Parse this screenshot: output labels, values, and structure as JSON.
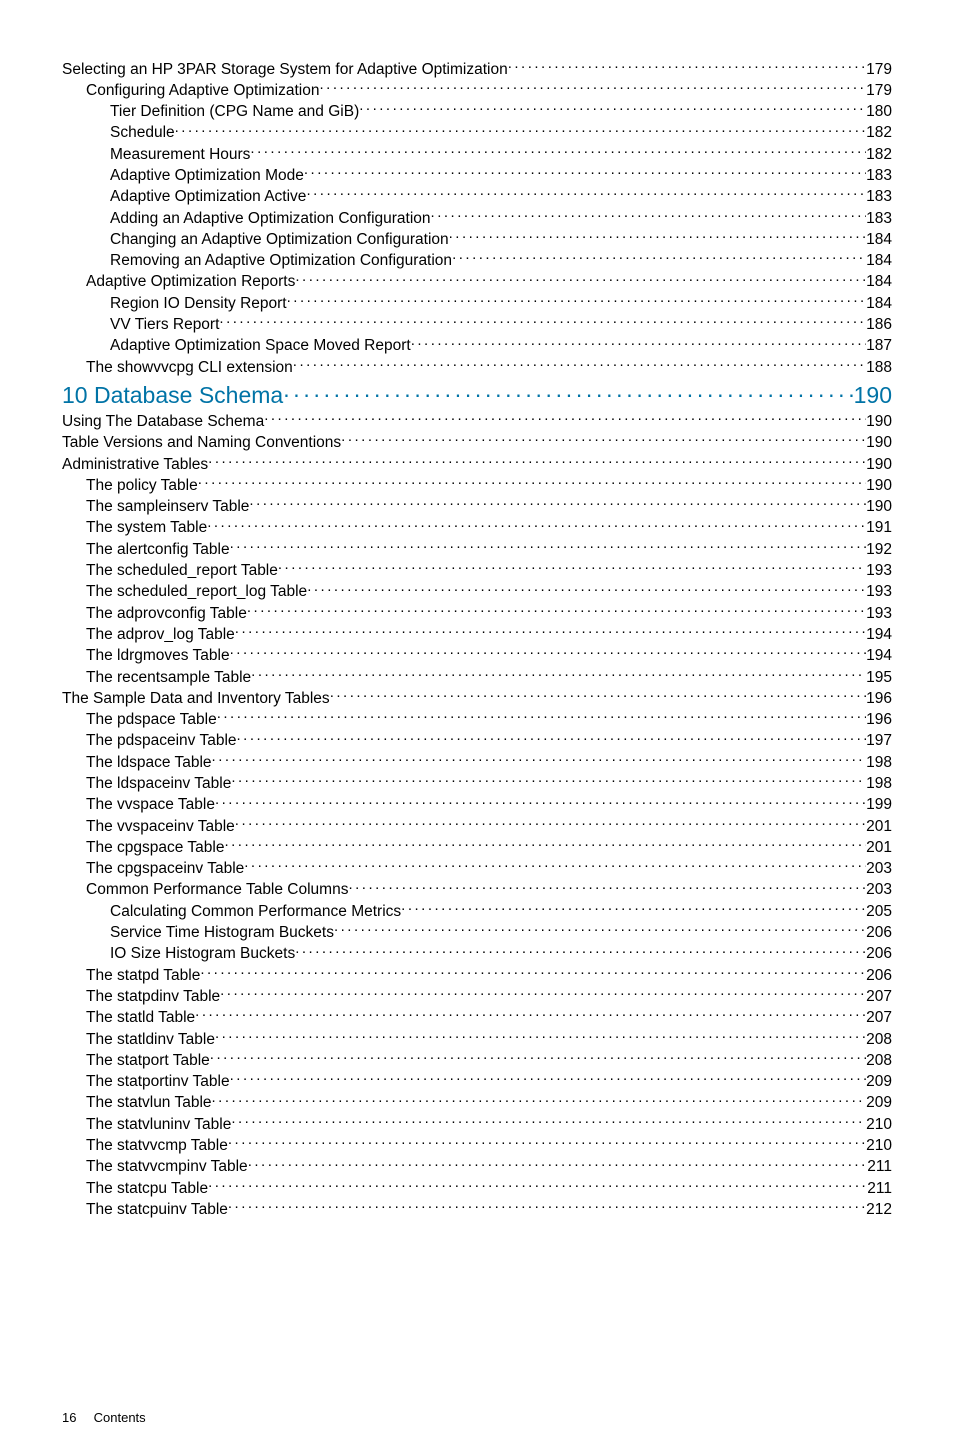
{
  "toc": [
    {
      "level": 0,
      "title": "Selecting an HP 3PAR Storage System for Adaptive Optimization",
      "page": "179",
      "style": "normal"
    },
    {
      "level": 1,
      "title": "Configuring Adaptive Optimization",
      "page": "179",
      "style": "normal"
    },
    {
      "level": 2,
      "title": "Tier Definition (CPG Name and GiB)",
      "page": "180",
      "style": "normal"
    },
    {
      "level": 2,
      "title": "Schedule",
      "page": "182",
      "style": "normal"
    },
    {
      "level": 2,
      "title": "Measurement  Hours",
      "page": "182",
      "style": "normal"
    },
    {
      "level": 2,
      "title": "Adaptive Optimization Mode",
      "page": "183",
      "style": "normal"
    },
    {
      "level": 2,
      "title": "Adaptive Optimization Active",
      "page": "183",
      "style": "normal"
    },
    {
      "level": 2,
      "title": "Adding an Adaptive Optimization Configuration",
      "page": "183",
      "style": "normal"
    },
    {
      "level": 2,
      "title": "Changing an Adaptive Optimization Configuration",
      "page": "184",
      "style": "normal"
    },
    {
      "level": 2,
      "title": "Removing an Adaptive Optimization Configuration",
      "page": "184",
      "style": "normal"
    },
    {
      "level": 1,
      "title": "Adaptive Optimization Reports",
      "page": "184",
      "style": "normal"
    },
    {
      "level": 2,
      "title": "Region IO Density Report",
      "page": "184",
      "style": "normal"
    },
    {
      "level": 2,
      "title": "VV Tiers Report",
      "page": "186",
      "style": "normal"
    },
    {
      "level": 2,
      "title": "Adaptive Optimization Space Moved Report",
      "page": "187",
      "style": "normal"
    },
    {
      "level": 1,
      "title": "The showvvcpg CLI extension",
      "page": "188",
      "style": "normal"
    },
    {
      "level": 0,
      "title": "10 Database Schema",
      "page": "190",
      "style": "chapter"
    },
    {
      "level": 0,
      "title": "Using The Database Schema",
      "page": "190",
      "style": "normal"
    },
    {
      "level": 0,
      "title": "Table Versions and Naming Conventions",
      "page": "190",
      "style": "normal"
    },
    {
      "level": 0,
      "title": "Administrative Tables",
      "page": "190",
      "style": "normal"
    },
    {
      "level": 1,
      "title": "The policy Table",
      "page": "190",
      "style": "normal"
    },
    {
      "level": 1,
      "title": "The sampleinserv Table",
      "page": "190",
      "style": "normal"
    },
    {
      "level": 1,
      "title": "The system Table",
      "page": "191",
      "style": "normal"
    },
    {
      "level": 1,
      "title": "The alertconfig Table",
      "page": "192",
      "style": "normal"
    },
    {
      "level": 1,
      "title": "The scheduled_report Table",
      "page": "193",
      "style": "normal"
    },
    {
      "level": 1,
      "title": "The scheduled_report_log Table",
      "page": "193",
      "style": "normal"
    },
    {
      "level": 1,
      "title": "The adprovconfig Table",
      "page": "193",
      "style": "normal"
    },
    {
      "level": 1,
      "title": "The adprov_log Table",
      "page": "194",
      "style": "normal"
    },
    {
      "level": 1,
      "title": "The ldrgmoves Table",
      "page": "194",
      "style": "normal"
    },
    {
      "level": 1,
      "title": "The recentsample Table",
      "page": "195",
      "style": "normal"
    },
    {
      "level": 0,
      "title": "The Sample Data and Inventory Tables",
      "page": "196",
      "style": "normal"
    },
    {
      "level": 1,
      "title": "The pdspace Table",
      "page": "196",
      "style": "normal"
    },
    {
      "level": 1,
      "title": "The pdspaceinv Table",
      "page": "197",
      "style": "normal"
    },
    {
      "level": 1,
      "title": "The ldspace Table",
      "page": "198",
      "style": "normal"
    },
    {
      "level": 1,
      "title": "The ldspaceinv Table",
      "page": "198",
      "style": "normal"
    },
    {
      "level": 1,
      "title": "The vvspace Table",
      "page": "199",
      "style": "normal"
    },
    {
      "level": 1,
      "title": "The vvspaceinv Table",
      "page": "201",
      "style": "normal"
    },
    {
      "level": 1,
      "title": "The cpgspace Table",
      "page": "201",
      "style": "normal"
    },
    {
      "level": 1,
      "title": "The cpgspaceinv Table",
      "page": "203",
      "style": "normal"
    },
    {
      "level": 1,
      "title": "Common Performance Table Columns",
      "page": "203",
      "style": "normal"
    },
    {
      "level": 2,
      "title": "Calculating Common Performance Metrics",
      "page": "205",
      "style": "normal"
    },
    {
      "level": 2,
      "title": "Service Time Histogram Buckets",
      "page": "206",
      "style": "normal"
    },
    {
      "level": 2,
      "title": "IO Size Histogram Buckets",
      "page": "206",
      "style": "normal"
    },
    {
      "level": 1,
      "title": "The statpd Table",
      "page": "206",
      "style": "normal"
    },
    {
      "level": 1,
      "title": "The statpdinv Table",
      "page": "207",
      "style": "normal"
    },
    {
      "level": 1,
      "title": "The statld Table",
      "page": "207",
      "style": "normal"
    },
    {
      "level": 1,
      "title": "The statldinv Table",
      "page": "208",
      "style": "normal"
    },
    {
      "level": 1,
      "title": "The statport Table",
      "page": "208",
      "style": "normal"
    },
    {
      "level": 1,
      "title": "The statportinv Table",
      "page": "209",
      "style": "normal"
    },
    {
      "level": 1,
      "title": "The statvlun Table",
      "page": "209",
      "style": "normal"
    },
    {
      "level": 1,
      "title": "The statvluninv Table",
      "page": "210",
      "style": "normal"
    },
    {
      "level": 1,
      "title": "The statvvcmp Table",
      "page": "210",
      "style": "normal"
    },
    {
      "level": 1,
      "title": "The statvvcmpinv Table",
      "page": "211",
      "style": "normal"
    },
    {
      "level": 1,
      "title": "The statcpu Table",
      "page": "211",
      "style": "normal"
    },
    {
      "level": 1,
      "title": "The statcpuinv Table",
      "page": "212",
      "style": "normal"
    }
  ],
  "footer": {
    "page_number": "16",
    "section_label": "Contents"
  }
}
